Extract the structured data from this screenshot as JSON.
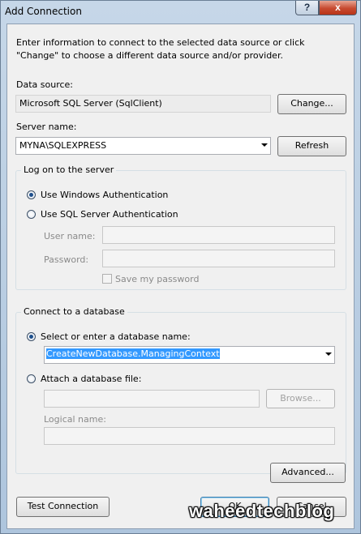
{
  "window": {
    "title": "Add Connection",
    "help_glyph": "?",
    "close_glyph": "x",
    "intro_text": "Enter information to connect to the selected data source or click \"Change\" to choose a different data source and/or provider."
  },
  "data_source": {
    "label": "Data source:",
    "value": "Microsoft SQL Server (SqlClient)",
    "change_button": "Change..."
  },
  "server": {
    "label": "Server name:",
    "value": "MYNA\\SQLEXPRESS",
    "refresh_button": "Refresh"
  },
  "logon": {
    "group_title": "Log on to the server",
    "windows_auth": "Use Windows Authentication",
    "sql_auth": "Use SQL Server Authentication",
    "user_name_label": "User name:",
    "password_label": "Password:",
    "save_password": "Save my password"
  },
  "database": {
    "group_title": "Connect to a database",
    "select_label": "Select or enter a database name:",
    "select_value": "CreateNewDatabase.ManagingContext",
    "attach_label": "Attach a database file:",
    "browse_button": "Browse...",
    "logical_name_label": "Logical name:"
  },
  "buttons": {
    "advanced": "Advanced...",
    "test_connection": "Test Connection",
    "ok": "OK",
    "cancel": "Cancel"
  },
  "watermark": "waheedtechblog"
}
